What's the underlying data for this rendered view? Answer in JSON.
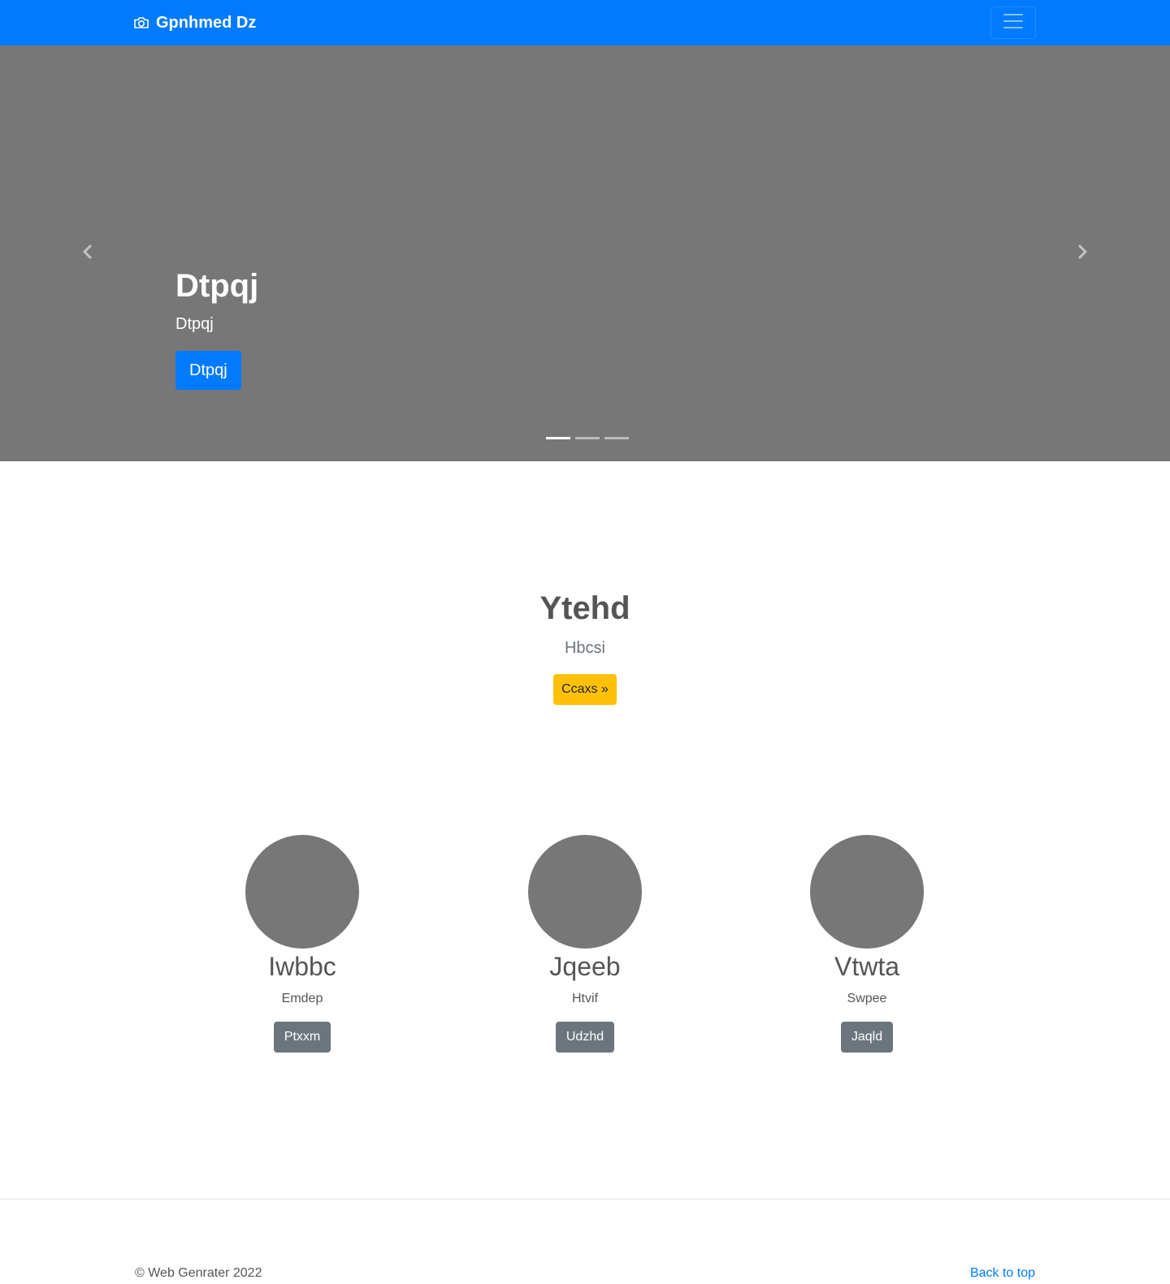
{
  "navbar": {
    "brand": "Gpnhmed Dz",
    "brand_icon": "camera-icon",
    "toggler_icon": "menu-icon",
    "background": "#007bff"
  },
  "carousel": {
    "title": "Dtpqj",
    "subtitle": "Dtpqj",
    "button_label": "Dtpqj",
    "prev_icon": "chevron-left-icon",
    "next_icon": "chevron-right-icon",
    "slide_count": 3,
    "active_index": 0,
    "background": "#777777"
  },
  "hero": {
    "title": "Ytehd",
    "lead": "Hbcsi",
    "button_label": "Ccaxs »",
    "button_color": "#ffc107"
  },
  "features": [
    {
      "title": "Iwbbc",
      "text": "Emdep",
      "button_label": "Ptxxm"
    },
    {
      "title": "Jqeeb",
      "text": "Htvif",
      "button_label": "Udzhd"
    },
    {
      "title": "Vtwta",
      "text": "Swpee",
      "button_label": "Jaqld"
    }
  ],
  "footer": {
    "copyright": "© Web Genrater 2022",
    "back_to_top": "Back to top"
  }
}
